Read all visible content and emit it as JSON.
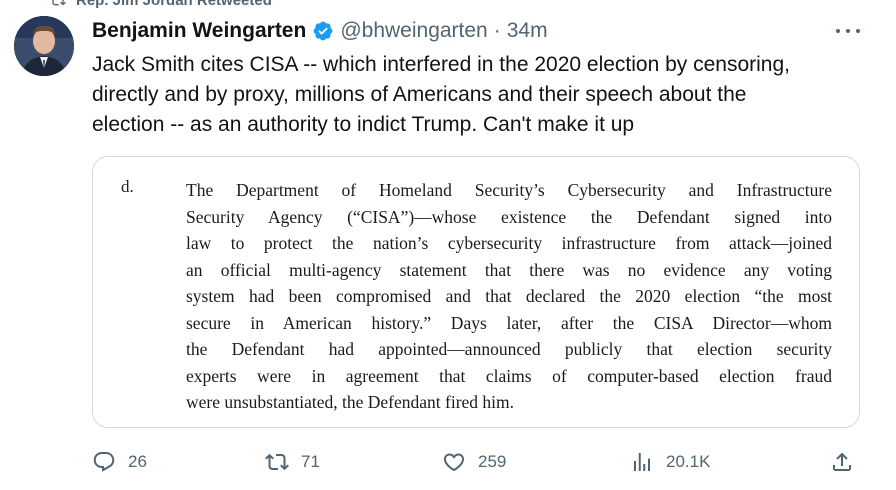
{
  "retweet": {
    "label": "Rep. Jim Jordan Retweeted",
    "icon": "retweet-icon"
  },
  "tweet": {
    "author_name": "Benjamin Weingarten",
    "handle": "@bhweingarten",
    "separator": "·",
    "time": "34m",
    "text_lines": [
      "Jack Smith cites CISA -- which interfered in the 2020 election by censoring,",
      "directly and by proxy, millions of Americans and their speech about the",
      "election -- as an authority to indict Trump. Can't make it up"
    ]
  },
  "document": {
    "label": "d.",
    "lines": [
      "The Department of Homeland Security’s Cybersecurity and Infrastructure",
      "Security Agency (“CISA”)—whose existence the Defendant signed into",
      "law to protect the nation’s cybersecurity infrastructure from attack—joined",
      "an official multi-agency statement that there was no evidence any voting",
      "system had been compromised and that declared the 2020 election “the most",
      "secure in American history.”  Days later, after the CISA Director—whom",
      "the Defendant had appointed—announced publicly that election security",
      "experts were in agreement that claims of computer-based election fraud",
      "were unsubstantiated, the Defendant fired him."
    ]
  },
  "actions": {
    "replies": "26",
    "retweets": "71",
    "likes": "259",
    "views": "20.1K"
  },
  "colors": {
    "verified": "#1d9bf0",
    "muted": "#536471",
    "text": "#0f1419",
    "border": "#cfd9de"
  }
}
